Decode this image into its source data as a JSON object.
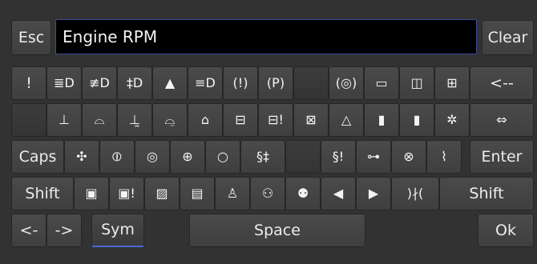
{
  "top": {
    "esc_label": "Esc",
    "display_value": "Engine RPM",
    "clear_label": "Clear"
  },
  "rows": [
    [
      {
        "label": "!",
        "name": "exclamation-key",
        "icon": false
      },
      {
        "label": "≣D",
        "name": "high-beam-icon",
        "icon": true
      },
      {
        "label": "≢D",
        "name": "low-beam-icon",
        "icon": true
      },
      {
        "label": "‡D",
        "name": "fog-light-icon",
        "icon": true
      },
      {
        "label": "▲",
        "name": "hazard-warning-icon",
        "icon": true
      },
      {
        "label": "≡D",
        "name": "parking-light-icon",
        "icon": true
      },
      {
        "label": "(!)",
        "name": "brake-warning-icon",
        "icon": true
      },
      {
        "label": "(P)",
        "name": "parking-brake-icon",
        "icon": true
      },
      {
        "label": "",
        "name": "blank-key",
        "icon": true
      },
      {
        "label": "(◎)",
        "name": "tire-pressure-icon",
        "icon": true
      },
      {
        "label": "▭",
        "name": "door-open-icon",
        "icon": true
      },
      {
        "label": "◫",
        "name": "trunk-open-icon",
        "icon": true
      },
      {
        "label": "⊞",
        "name": "battery-charge-icon",
        "icon": true
      },
      {
        "label": "<--",
        "name": "backspace-key",
        "icon": false
      }
    ],
    [
      {
        "label": "",
        "name": "blank-key",
        "icon": true
      },
      {
        "label": "⊥",
        "name": "coolant-temp-icon",
        "icon": true
      },
      {
        "label": "⌓",
        "name": "oil-pressure-icon",
        "icon": true
      },
      {
        "label": "⊥̰",
        "name": "coolant-level-icon",
        "icon": true
      },
      {
        "label": "⌓̰",
        "name": "oil-level-icon",
        "icon": true
      },
      {
        "label": "⌂",
        "name": "engine-check-icon",
        "icon": true
      },
      {
        "label": "⊟",
        "name": "battery-icon",
        "icon": true
      },
      {
        "label": "⊟!",
        "name": "battery-warning-icon",
        "icon": true
      },
      {
        "label": "⊠",
        "name": "battery-fault-icon",
        "icon": true
      },
      {
        "label": "△",
        "name": "warning-triangle-icon",
        "icon": true
      },
      {
        "label": "▮",
        "name": "fuel-nozzle-icon",
        "icon": true
      },
      {
        "label": "▮",
        "name": "fluid-bottle-icon",
        "icon": true
      },
      {
        "label": "✲",
        "name": "seatbelt-icon",
        "icon": true
      },
      {
        "label": "⇔",
        "name": "wiper-fluid-icon",
        "icon": true
      }
    ],
    [
      {
        "label": "Caps",
        "name": "caps-key",
        "icon": false
      },
      {
        "label": "✣",
        "name": "fan-icon",
        "icon": true
      },
      {
        "label": "⦶",
        "name": "abs-icon",
        "icon": true
      },
      {
        "label": "◎",
        "name": "tire-icon",
        "icon": true
      },
      {
        "label": "⊕",
        "name": "brake-pad-icon",
        "icon": true
      },
      {
        "label": "○",
        "name": "circle-icon",
        "icon": true
      },
      {
        "label": "§‡",
        "name": "glow-plug-icon",
        "icon": true
      },
      {
        "label": "",
        "name": "blank-key",
        "icon": true
      },
      {
        "label": "§!",
        "name": "glow-plug-warning-icon",
        "icon": true
      },
      {
        "label": "⊶",
        "name": "traction-control-icon",
        "icon": true
      },
      {
        "label": "⊗",
        "name": "stability-off-icon",
        "icon": true
      },
      {
        "label": "⌇",
        "name": "water-in-fuel-icon",
        "icon": true
      },
      {
        "label": "Enter",
        "name": "enter-key",
        "icon": false
      }
    ],
    [
      {
        "label": "Shift",
        "name": "shift-left-key",
        "icon": false
      },
      {
        "label": "▣",
        "name": "fuel-gauge-icon",
        "icon": true
      },
      {
        "label": "▣!",
        "name": "low-fuel-icon",
        "icon": true
      },
      {
        "label": "▨",
        "name": "fuel-filter-icon",
        "icon": true
      },
      {
        "label": "▤",
        "name": "fuel-pump-icon",
        "icon": true
      },
      {
        "label": "♙",
        "name": "airbag-icon",
        "icon": true
      },
      {
        "label": "⚇",
        "name": "vehicle-skid-icon",
        "icon": true
      },
      {
        "label": "⚉",
        "name": "vehicle-skid-off-icon",
        "icon": true
      },
      {
        "label": "◀",
        "name": "arrow-left-icon",
        "icon": true
      },
      {
        "label": "▶",
        "name": "arrow-right-icon",
        "icon": true
      },
      {
        "label": ")∤(",
        "name": "lane-assist-icon",
        "icon": true
      },
      {
        "label": "Shift",
        "name": "shift-right-key",
        "icon": false
      }
    ],
    [
      {
        "label": "<-",
        "name": "cursor-left-key",
        "icon": false
      },
      {
        "label": "->",
        "name": "cursor-right-key",
        "icon": false
      },
      {
        "label": "Sym",
        "name": "sym-key",
        "icon": false
      },
      {
        "label": "Space",
        "name": "space-key",
        "icon": false
      },
      {
        "label": "Ok",
        "name": "ok-key",
        "icon": false
      }
    ]
  ]
}
